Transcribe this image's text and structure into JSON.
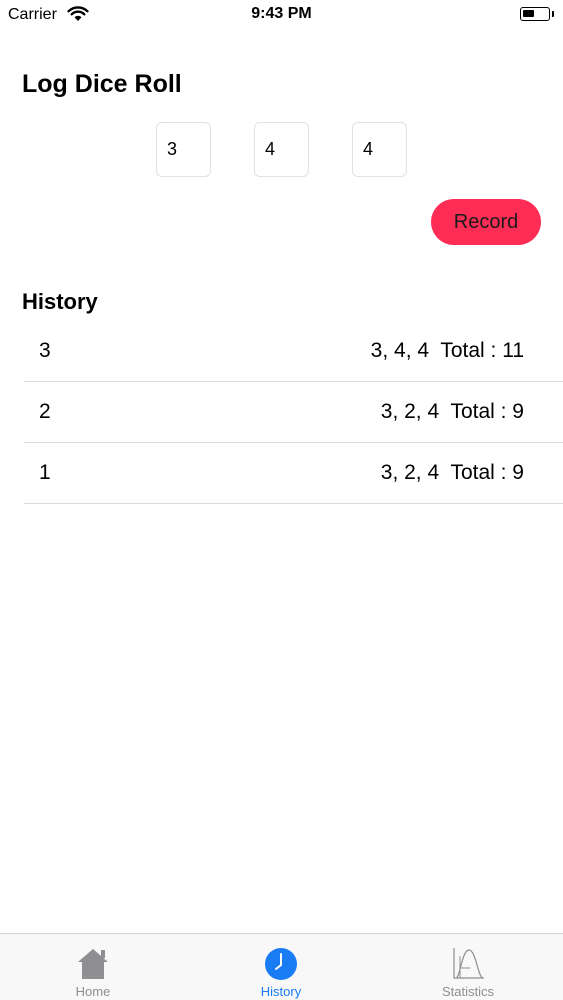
{
  "status_bar": {
    "carrier": "Carrier",
    "time": "9:43 PM",
    "battery_level": 0.45
  },
  "log_section": {
    "title": "Log Dice Roll",
    "dice_values": [
      "3",
      "4",
      "4"
    ],
    "record_label": "Record"
  },
  "history": {
    "title": "History",
    "rows": [
      {
        "index": "3",
        "detail": "3, 4, 4  Total : 11"
      },
      {
        "index": "2",
        "detail": "3, 2, 4  Total : 9"
      },
      {
        "index": "1",
        "detail": "3, 2, 4  Total : 9"
      }
    ]
  },
  "tab_bar": {
    "tabs": [
      {
        "label": "Home",
        "icon": "house-icon",
        "selected": false
      },
      {
        "label": "History",
        "icon": "clock-icon",
        "selected": true
      },
      {
        "label": "Statistics",
        "icon": "bell-curve-icon",
        "selected": false
      }
    ]
  },
  "colors": {
    "accent": "#1a7cf5",
    "record_button": "#fe2d55",
    "tab_inactive": "#8e8e93"
  }
}
